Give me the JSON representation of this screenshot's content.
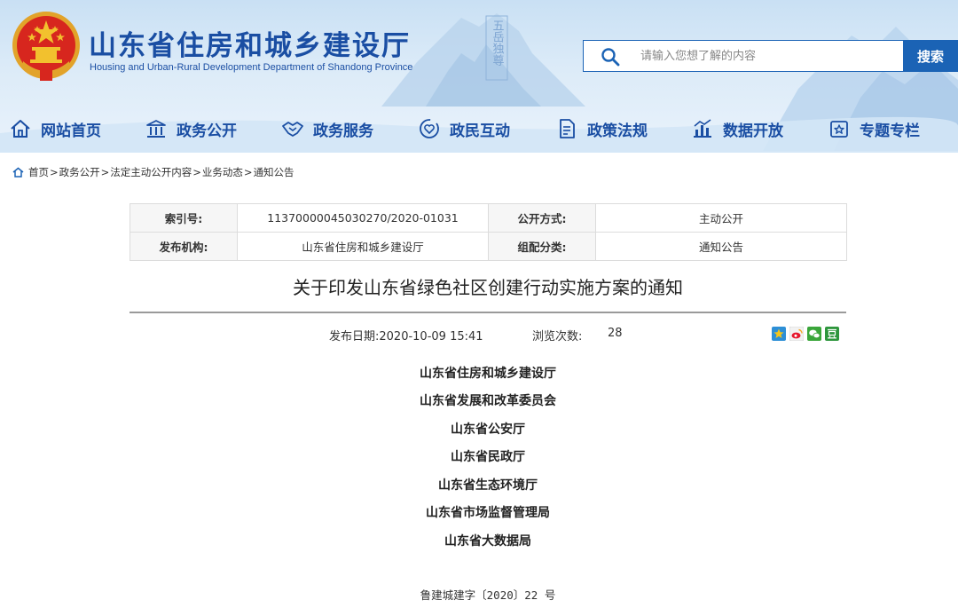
{
  "header": {
    "title": "山东省住房和城乡建设厅",
    "subtitle": "Housing and Urban-Rural Development Department of Shandong Province",
    "seal_text": "五岳独尊",
    "search": {
      "placeholder": "请输入您想了解的内容",
      "button_label": "搜索"
    },
    "colors": {
      "brand": "#1a4ea3",
      "accent": "#1b63b5",
      "emblem_red": "#d7261e",
      "emblem_gold": "#f2c12e"
    }
  },
  "nav": {
    "items": [
      {
        "label": "网站首页",
        "icon": "home-icon"
      },
      {
        "label": "政务公开",
        "icon": "government-building-icon"
      },
      {
        "label": "政务服务",
        "icon": "handshake-icon"
      },
      {
        "label": "政民互动",
        "icon": "heart-interaction-icon"
      },
      {
        "label": "政策法规",
        "icon": "policy-document-icon"
      },
      {
        "label": "数据开放",
        "icon": "bar-chart-icon"
      },
      {
        "label": "专题专栏",
        "icon": "topic-folder-icon"
      }
    ]
  },
  "breadcrumb": {
    "items": [
      "首页",
      "政务公开",
      "法定主动公开内容",
      "业务动态",
      "通知公告"
    ],
    "separator": ">"
  },
  "info": {
    "index_label": "索引号:",
    "index_value": "113700000450302​70/2020-01031",
    "mode_label": "公开方式:",
    "mode_value": "主动公开",
    "publisher_label": "发布机构:",
    "publisher_value": "山东省住房和城乡建设厅",
    "category_label": "组配分类:",
    "category_value": "通知公告"
  },
  "article": {
    "title": "关于印发山东省绿色社区创建行动实施方案的通知",
    "publish_label": "发布日期:",
    "publish_date": "2020-10-09 15:41",
    "views_label": "浏览次数:",
    "views": "28",
    "share_icons": [
      "qzone-icon",
      "weibo-icon",
      "wechat-icon",
      "douban-icon"
    ],
    "orgs": [
      "山东省住房和城乡建设厅",
      "山东省发展和改革委员会",
      "山东省公安厅",
      "山东省民政厅",
      "山东省生态环境厅",
      "山东省市场监督管理局",
      "山东省大数据局"
    ],
    "doc_number": "鲁建城建字〔2020〕22 号"
  }
}
